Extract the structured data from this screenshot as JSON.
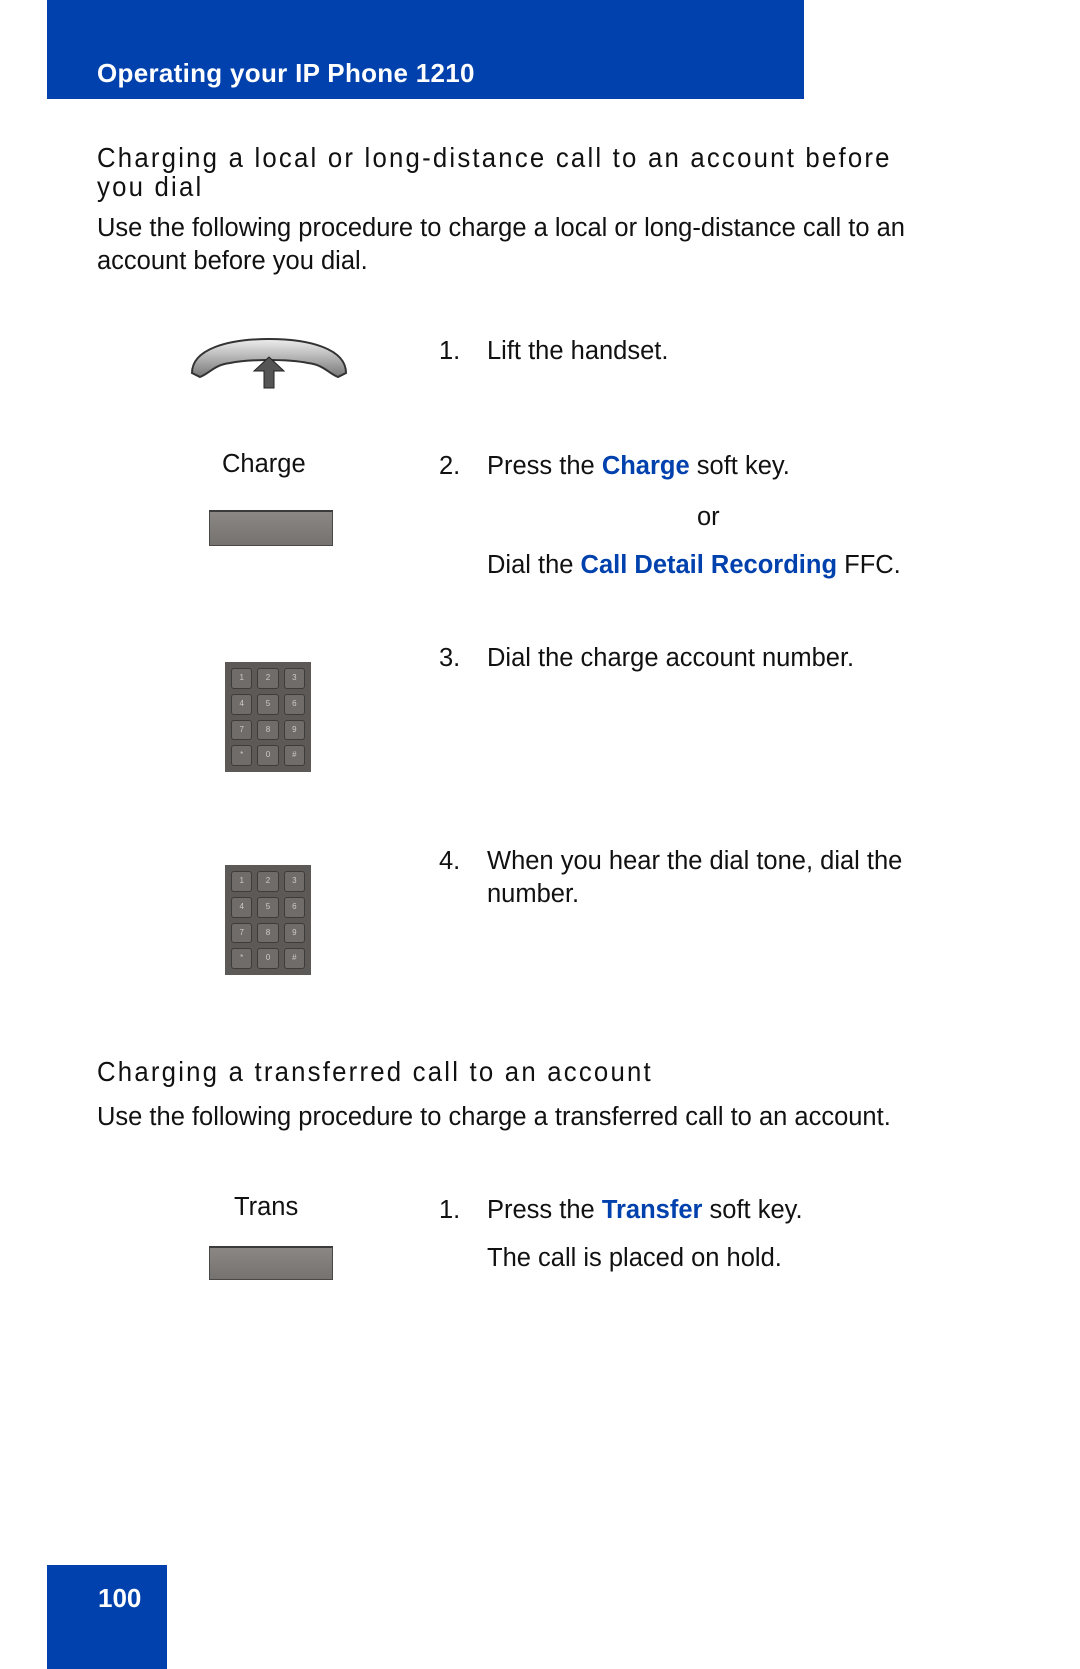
{
  "header": {
    "title": "Operating your IP Phone 1210",
    "color": "#0041ad"
  },
  "section1": {
    "heading_line1": "Charging a local or long-distance call to an account before",
    "heading_line2": "you dial",
    "intro_line1": "Use the following procedure to charge a local or long-distance call to an",
    "intro_line2": "account before you dial.",
    "steps": [
      {
        "num": "1.",
        "text": "Lift the handset.",
        "icon": "handset-lift-icon"
      },
      {
        "num": "2.",
        "pre": "Press the ",
        "key": "Charge",
        "post": " soft key.",
        "softkey_label": "Charge",
        "or": "or",
        "alt_pre": "Dial the ",
        "alt_key": "Call Detail Recording",
        "alt_post": " FFC."
      },
      {
        "num": "3.",
        "text": "Dial the charge account number.",
        "icon": "keypad-icon"
      },
      {
        "num": "4.",
        "line1": "When you hear the dial tone, dial the",
        "line2": "number.",
        "icon": "keypad-icon"
      }
    ]
  },
  "section2": {
    "heading": "Charging a transferred call to an account",
    "intro": "Use the following procedure to charge a transferred call to an account.",
    "steps": [
      {
        "num": "1.",
        "pre": "Press the ",
        "key": "Transfer",
        "post": " soft key.",
        "softkey_label": "Trans",
        "note": "The call is placed on hold."
      }
    ]
  },
  "keypad_keys": [
    "1",
    "2",
    "3",
    "4",
    "5",
    "6",
    "7",
    "8",
    "9",
    "*",
    "0",
    "#"
  ],
  "footer": {
    "page_number": "100"
  }
}
